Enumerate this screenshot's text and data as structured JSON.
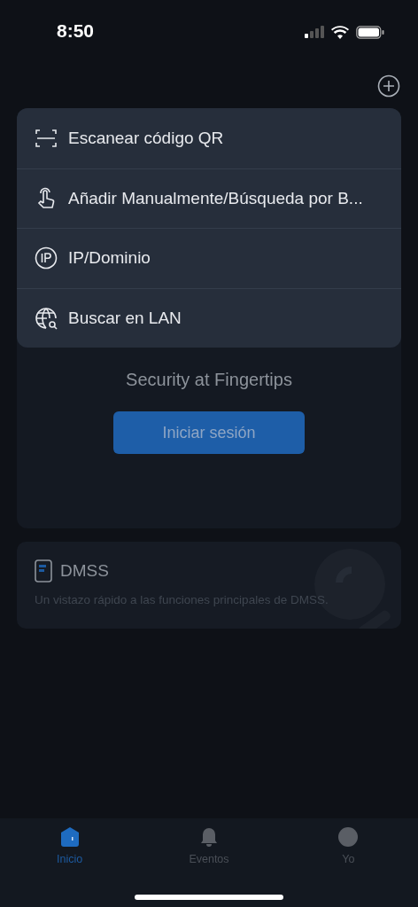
{
  "status_bar": {
    "time": "8:50"
  },
  "add_menu": {
    "items": [
      {
        "kind": "scan",
        "label": "Escanear código QR"
      },
      {
        "kind": "manual",
        "label": "Añadir Manualmente/Búsqueda por B..."
      },
      {
        "kind": "ip",
        "label": "IP/Dominio"
      },
      {
        "kind": "lan",
        "label": "Buscar en LAN"
      }
    ]
  },
  "login_card": {
    "slogan": "Security at Fingertips",
    "button": "Iniciar sesión"
  },
  "info_card": {
    "title": "DMSS",
    "description": "Un vistazo rápido a las funciones principales de DMSS."
  },
  "tab_bar": [
    {
      "kind": "home",
      "label": "Inicio",
      "selected": true
    },
    {
      "kind": "events",
      "label": "Eventos",
      "selected": false
    },
    {
      "kind": "me",
      "label": "Yo",
      "selected": false
    }
  ]
}
